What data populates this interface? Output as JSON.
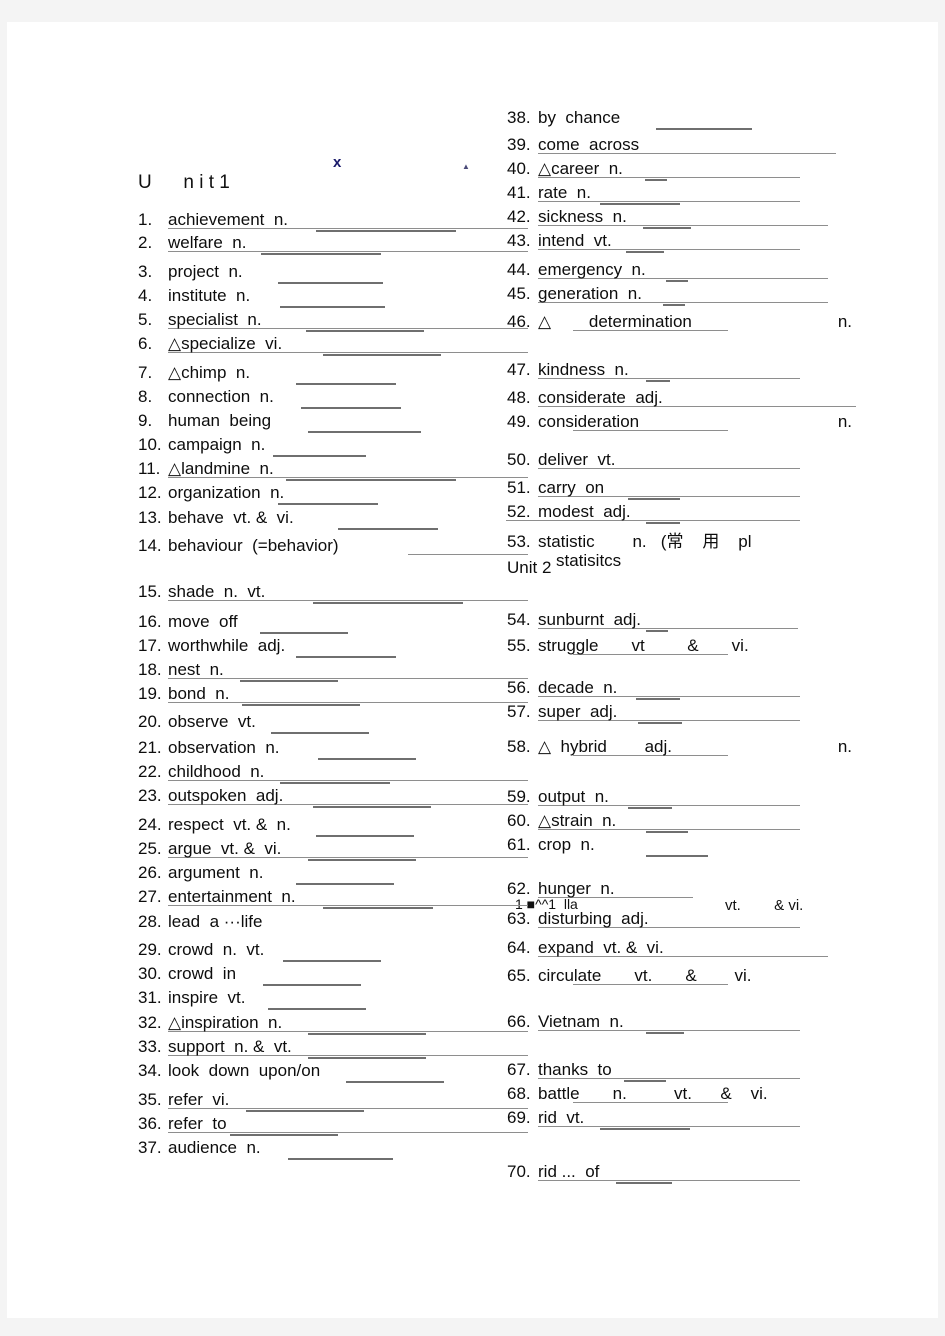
{
  "page": {
    "header_marks": {
      "x_mark": "x",
      "tiny_mark": "▲"
    },
    "unit_title": "U      n i t 1",
    "section_heading": "Unit 2",
    "artifact_line": "1 ■^^1  lla"
  },
  "left_column": [
    {
      "num": "1.",
      "text": "achievement  n."
    },
    {
      "num": "2.",
      "text": "welfare  n."
    },
    {
      "num": "3.",
      "text": "project  n."
    },
    {
      "num": "4.",
      "text": "institute  n."
    },
    {
      "num": "5.",
      "text": "specialist  n."
    },
    {
      "num": "6.",
      "text": "△specialize  vi."
    },
    {
      "num": "7.",
      "text": "△chimp  n."
    },
    {
      "num": "8.",
      "text": "connection  n."
    },
    {
      "num": "9.",
      "text": "human  being"
    },
    {
      "num": "10.",
      "text": "campaign  n."
    },
    {
      "num": "11.",
      "text": "△landmine  n."
    },
    {
      "num": "12.",
      "text": "organization  n."
    },
    {
      "num": "13.",
      "text": "behave  vt. &  vi."
    },
    {
      "num": "14.",
      "text": "behaviour  (=behavior)"
    },
    {
      "num": "15.",
      "text": "shade  n.  vt."
    },
    {
      "num": "16.",
      "text": "move  off"
    },
    {
      "num": "17.",
      "text": "worthwhile  adj."
    },
    {
      "num": "18.",
      "text": "nest  n."
    },
    {
      "num": "19.",
      "text": "bond  n."
    },
    {
      "num": "20.",
      "text": "observe  vt."
    },
    {
      "num": "21.",
      "text": "observation  n."
    },
    {
      "num": "22.",
      "text": "childhood  n."
    },
    {
      "num": "23.",
      "text": "outspoken  adj."
    },
    {
      "num": "24.",
      "text": "respect  vt. &  n."
    },
    {
      "num": "25.",
      "text": "argue  vt. &  vi."
    },
    {
      "num": "26.",
      "text": "argument  n."
    },
    {
      "num": "27.",
      "text": "entertainment  n."
    },
    {
      "num": "28.",
      "text": "lead  a ···life"
    },
    {
      "num": "29.",
      "text": "crowd  n.  vt."
    },
    {
      "num": "30.",
      "text": "crowd  in"
    },
    {
      "num": "31.",
      "text": "inspire  vt."
    },
    {
      "num": "32.",
      "text": "△inspiration  n."
    },
    {
      "num": "33.",
      "text": "support  n. &  vt."
    },
    {
      "num": "34.",
      "text": "look  down  upon/on"
    },
    {
      "num": "35.",
      "text": "refer  vi."
    },
    {
      "num": "36.",
      "text": "refer  to"
    },
    {
      "num": "37.",
      "text": "audience  n."
    }
  ],
  "right_column": [
    {
      "num": "38.",
      "text": "by  chance"
    },
    {
      "num": "39.",
      "text": "come  across"
    },
    {
      "num": "40.",
      "text": "△career  n."
    },
    {
      "num": "41.",
      "text": "rate  n."
    },
    {
      "num": "42.",
      "text": "sickness  n."
    },
    {
      "num": "43.",
      "text": "intend  vt."
    },
    {
      "num": "44.",
      "text": "emergency  n."
    },
    {
      "num": "45.",
      "text": "generation  n."
    },
    {
      "num": "46.",
      "text": "△        determination",
      "tail": "n."
    },
    {
      "num": "47.",
      "text": "kindness  n."
    },
    {
      "num": "48.",
      "text": "considerate  adj."
    },
    {
      "num": "49.",
      "text": "consideration",
      "tail": "n."
    },
    {
      "num": "50.",
      "text": "deliver  vt."
    },
    {
      "num": "51.",
      "text": "carry  on"
    },
    {
      "num": "52.",
      "text": "modest  adj."
    },
    {
      "num": "53.",
      "text": "statistic        n.   (常    用    pl",
      "line2": "statisitcs"
    },
    {
      "num": "54.",
      "text": "sunburnt  adj."
    },
    {
      "num": "55.",
      "text": "struggle       vt         &       vi."
    },
    {
      "num": "56.",
      "text": "decade  n."
    },
    {
      "num": "57.",
      "text": "super  adj."
    },
    {
      "num": "58.",
      "text": "△  hybrid        adj.",
      "tail": "n."
    },
    {
      "num": "59.",
      "text": "output  n."
    },
    {
      "num": "60.",
      "text": "△strain  n."
    },
    {
      "num": "61.",
      "text": "crop  n."
    },
    {
      "num": "62.",
      "text": "hunger  n."
    },
    {
      "num": "63.",
      "text": "disturbing  adj."
    },
    {
      "num": "64.",
      "text": "expand  vt. &  vi."
    },
    {
      "num": "65.",
      "text": "circulate       vt.       &        vi."
    },
    {
      "num": "66.",
      "text": "Vietnam  n."
    },
    {
      "num": "67.",
      "text": "thanks  to"
    },
    {
      "num": "68.",
      "text": "battle       n.          vt.      &    vi."
    },
    {
      "num": "69.",
      "text": "rid  vt."
    },
    {
      "num": "70.",
      "text": "rid ...  of"
    }
  ]
}
